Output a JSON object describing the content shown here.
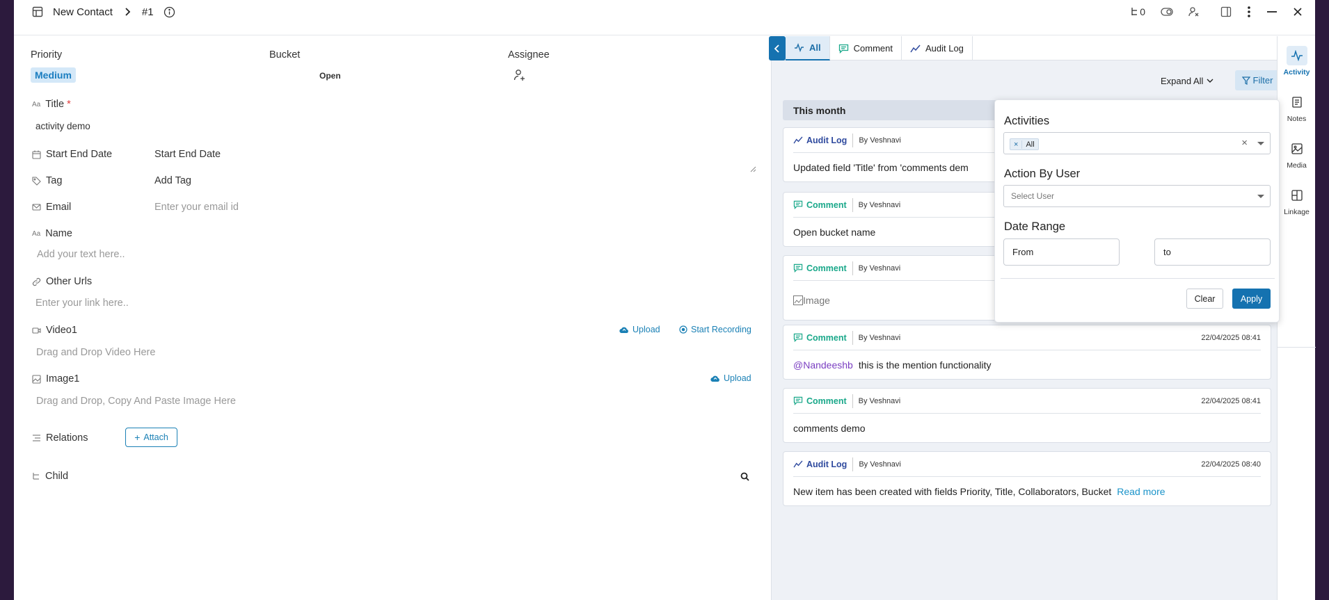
{
  "header": {
    "title": "New Contact",
    "item_id": "#1",
    "child_count": "0"
  },
  "form": {
    "priority_label": "Priority",
    "priority_value": "Medium",
    "bucket_label": "Bucket",
    "bucket_value": "Open",
    "assignee_label": "Assignee",
    "title_label": "Title",
    "title_required": "*",
    "title_value": "activity demo",
    "start_end_label": "Start End Date",
    "start_end_value": "Start End Date",
    "tag_label": "Tag",
    "tag_value": "Add Tag",
    "email_label": "Email",
    "email_placeholder": "Enter your email id",
    "name_label": "Name",
    "name_placeholder": "Add your text here..",
    "urls_label": "Other Urls",
    "urls_placeholder": "Enter your link here..",
    "video_label": "Video1",
    "video_upload": "Upload",
    "video_record": "Start Recording",
    "video_placeholder": "Drag and Drop Video Here",
    "image_label": "Image1",
    "image_upload": "Upload",
    "image_placeholder": "Drag and Drop, Copy And Paste Image Here",
    "relations_label": "Relations",
    "attach_label": "Attach",
    "child_label": "Child"
  },
  "activity": {
    "tabs": [
      "All",
      "Comment",
      "Audit Log"
    ],
    "expand_all": "Expand All",
    "filter": "Filter",
    "month_header": "This month",
    "cards": [
      {
        "type": "Audit Log",
        "by": "By Veshnavi",
        "time": "",
        "body": "Updated field 'Title' from 'comments dem"
      },
      {
        "type": "Comment",
        "by": "By Veshnavi",
        "time": "",
        "body": "Open bucket name"
      },
      {
        "type": "Comment",
        "by": "By Veshnavi",
        "time": "",
        "body": "Image"
      },
      {
        "type": "Comment",
        "by": "By Veshnavi",
        "time": "22/04/2025 08:41",
        "mention": "@Nandeeshb",
        "body": "this is the mention functionality"
      },
      {
        "type": "Comment",
        "by": "By Veshnavi",
        "time": "22/04/2025 08:41",
        "body": "comments demo"
      },
      {
        "type": "Audit Log",
        "by": "By Veshnavi",
        "time": "22/04/2025 08:40",
        "body": "New item has been created with fields Priority, Title, Collaborators, Bucket",
        "link": "Read more"
      }
    ]
  },
  "filter_popup": {
    "activities_heading": "Activities",
    "activities_chip": "All",
    "chip_remove": "×",
    "clear_symbol": "×",
    "action_by_heading": "Action By User",
    "action_by_placeholder": "Select User",
    "date_range_heading": "Date Range",
    "from_label": "From",
    "to_label": "to",
    "clear_button": "Clear",
    "apply_button": "Apply"
  },
  "rail": {
    "items": [
      "Activity",
      "Notes",
      "Media",
      "Linkage"
    ]
  },
  "colors": {
    "accent": "#1572b0",
    "comment": "#1aa88a",
    "audit": "#2f4a9e",
    "mention": "#7b3fc2"
  }
}
